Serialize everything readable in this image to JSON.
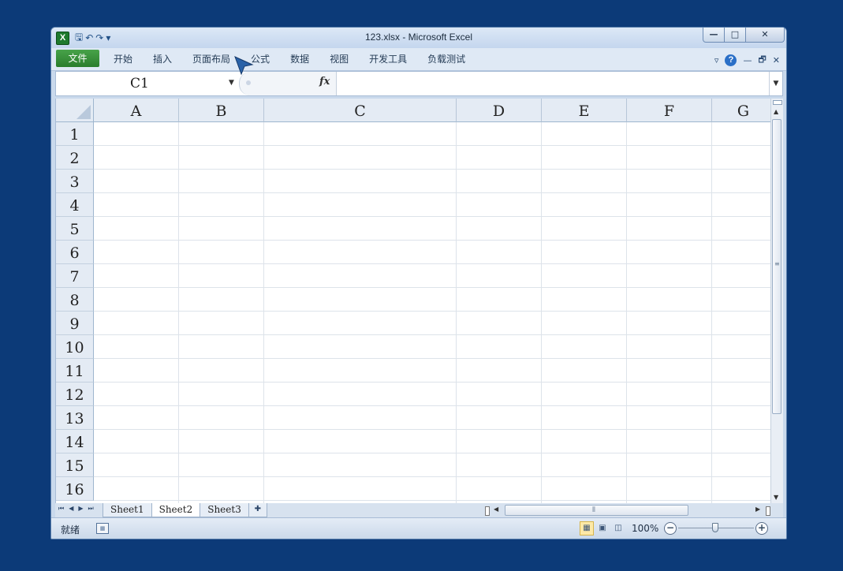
{
  "window": {
    "title": "123.xlsx - Microsoft Excel"
  },
  "app_icon": "X",
  "qat": {
    "save": "🖫",
    "undo": "↶",
    "redo": "↷",
    "customize": "▾"
  },
  "window_controls": {
    "minimize": "—",
    "maximize": "□",
    "close": "✕"
  },
  "ribbon": {
    "file": "文件",
    "tabs": [
      "开始",
      "插入",
      "页面布局",
      "公式",
      "数据",
      "视图",
      "开发工具",
      "负载测试"
    ]
  },
  "ribbon_controls": {
    "collapse": "▿",
    "help": "?",
    "min": "—",
    "restore": "🗗",
    "close": "✕"
  },
  "formula_bar": {
    "name_box": "C1",
    "fx": "fx",
    "formula": ""
  },
  "columns": [
    "A",
    "B",
    "C",
    "D",
    "E",
    "F",
    "G"
  ],
  "rows": [
    "1",
    "2",
    "3",
    "4",
    "5",
    "6",
    "7",
    "8",
    "9",
    "10",
    "11",
    "12",
    "13",
    "14",
    "15",
    "16"
  ],
  "sheets": {
    "tabs": [
      "Sheet1",
      "Sheet2",
      "Sheet3"
    ],
    "active": "Sheet2"
  },
  "status": {
    "ready": "就绪",
    "zoom": "100%"
  },
  "colors": {
    "accent": "#2a7d2c",
    "background": "#0c3a78"
  }
}
